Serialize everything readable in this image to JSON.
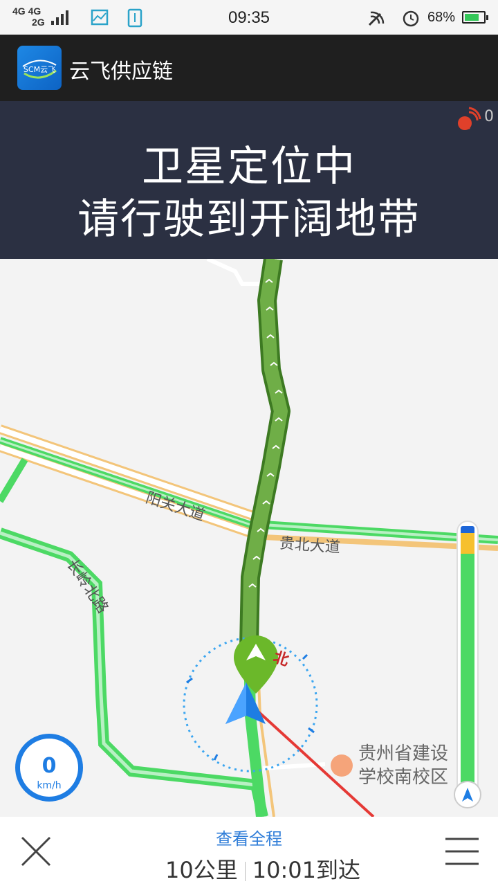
{
  "status_bar": {
    "network_line1": "4G 4G",
    "network_line2": "2G",
    "time": "09:35",
    "battery": "68%"
  },
  "app_bar": {
    "logo_text": "SCM云飞",
    "title": "云飞供应链"
  },
  "banner": {
    "gps_count": "0",
    "line1": "卫星定位中",
    "line2": "请行驶到开阔地带"
  },
  "map": {
    "road_labels": [
      "阳关大道",
      "贵北大道",
      "长岭北路"
    ],
    "north_label": "北",
    "poi_line1": "贵州省建设",
    "poi_line2": "学校南校区",
    "speed": "0",
    "speed_unit": "km/h"
  },
  "bottom_bar": {
    "overview": "查看全程",
    "distance": "10公里",
    "arrival": "10:01到达"
  },
  "colors": {
    "banner_bg": "#2b3042",
    "route_green": "#5a9a3a",
    "road_green": "#4cd964",
    "accent_blue": "#1e7de3"
  }
}
